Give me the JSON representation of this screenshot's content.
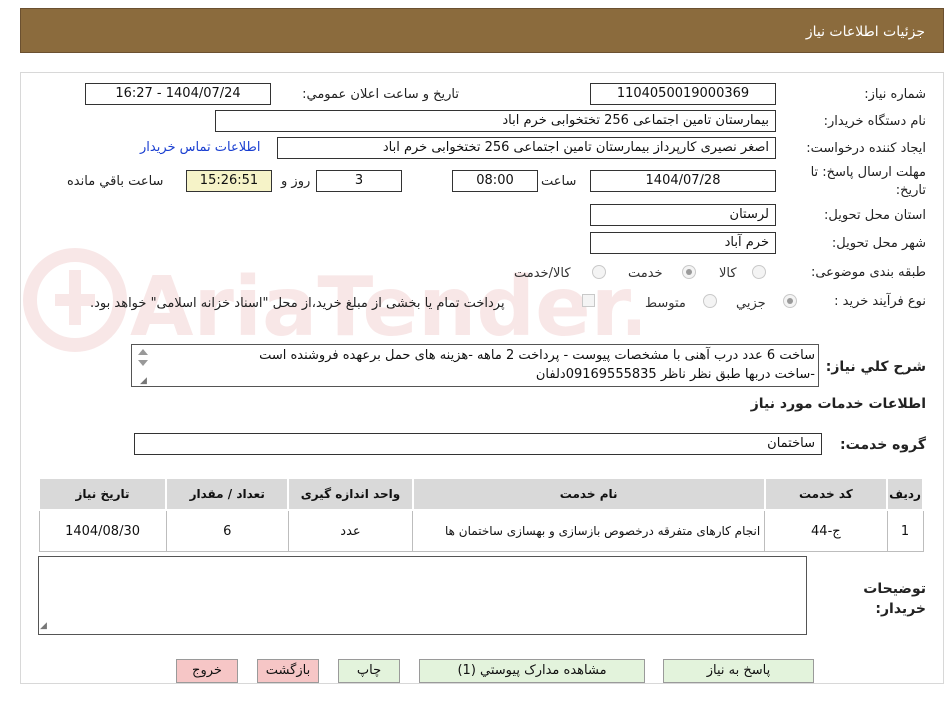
{
  "header": {
    "title": "جزئیات اطلاعات نیاز"
  },
  "form": {
    "need_number_label": "شماره نیاز:",
    "need_number": "1104050019000369",
    "announce_label": "تاریخ و ساعت اعلان عمومي:",
    "announce_value": "1404/07/24 - 16:27",
    "buyer_org_label": "نام دستگاه خریدار:",
    "buyer_org": "بیمارستان تامین اجتماعی  256 تختخوابی خرم اباد",
    "requester_label": "ایجاد کننده درخواست:",
    "requester": "اصغر نصیری کارپرداز بیمارستان تامین اجتماعی  256 تختخوابی خرم اباد",
    "contact_link": "اطلاعات تماس خریدار",
    "deadline_label": "مهلت ارسال پاسخ: تا تاریخ:",
    "deadline_date": "1404/07/28",
    "time_label": "ساعت",
    "deadline_time": "08:00",
    "days": "3",
    "days_label": "روز و",
    "remaining_time": "15:26:51",
    "remaining_label": "ساعت باقي مانده",
    "province_label": "استان محل تحویل:",
    "province": "لرستان",
    "city_label": "شهر محل تحویل:",
    "city": "خرم آباد",
    "category_label": "طبقه بندی موضوعی:",
    "category_options": [
      "کالا",
      "خدمت",
      "کالا/خدمت"
    ],
    "process_label": "نوع فرآیند خرید :",
    "process_options": [
      "جزيي",
      "متوسط"
    ],
    "payment_note": "پرداخت تمام یا بخشی از مبلغ خرید،از محل \"اسناد خزانه اسلامی\" خواهد بود.",
    "description_label": "شرح کلي نیاز:",
    "description_line1": "ساخت 6 عدد درب آهنی با مشخصات پیوست - پرداخت 2 ماهه -هزینه های حمل برعهده فروشنده است",
    "description_line2": "-ساخت دربها طبق نظر ناظر 09169555835دلفان",
    "services_title": "اطلاعات خدمات مورد نیاز",
    "service_group_label": "گروه خدمت:",
    "service_group": "ساختمان",
    "buyer_notes_label": "توضیحات خریدار:",
    "buyer_notes": ""
  },
  "table": {
    "headers": [
      "ردیف",
      "کد خدمت",
      "نام خدمت",
      "واحد اندازه گیری",
      "تعداد / مقدار",
      "تاریخ نیاز"
    ],
    "rows": [
      [
        "1",
        "ج-44",
        "انجام کارهای متفرقه درخصوص بازسازی و بهسازی ساختمان ها",
        "عدد",
        "6",
        "1404/08/30"
      ]
    ]
  },
  "buttons": {
    "reply": "پاسخ به نیاز",
    "attachments": "مشاهده مدارک پیوستي (1)",
    "print": "چاپ",
    "back": "بازگشت",
    "exit": "خروج"
  },
  "watermark": {
    "text": "AriaTender.neT"
  },
  "colors": {
    "header_bg": "#8b6b3d",
    "link": "#1a3fd1",
    "green_button": "#e3f3dc",
    "pink_button": "#f6c6c6",
    "timer_bg": "#f6f3c8"
  }
}
